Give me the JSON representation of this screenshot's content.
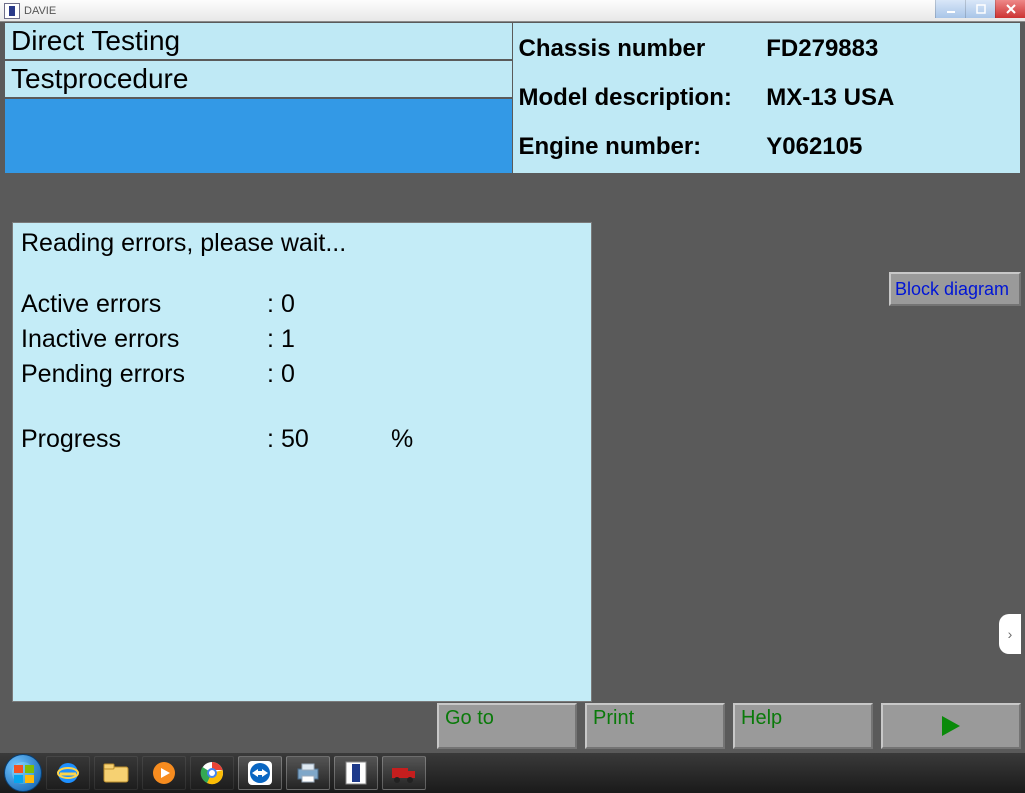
{
  "window": {
    "title": "DAVIE"
  },
  "header": {
    "left": {
      "row1": "Direct Testing",
      "row2": "Testprocedure"
    },
    "right": {
      "chassis_label": "Chassis number",
      "chassis_value": "FD279883",
      "model_label": "Model description:",
      "model_value": "MX-13 USA",
      "engine_label": "Engine number:",
      "engine_value": "Y062105"
    }
  },
  "status": {
    "heading": "Reading errors, please wait...",
    "active_label": "Active errors",
    "active_value": "0",
    "inactive_label": "Inactive errors",
    "inactive_value": "1",
    "pending_label": "Pending errors",
    "pending_value": "0",
    "progress_label": "Progress",
    "progress_value": "50",
    "progress_unit": "%"
  },
  "buttons": {
    "block_diagram": "Block diagram",
    "goto": "Go to",
    "print": "Print",
    "help": "Help"
  }
}
